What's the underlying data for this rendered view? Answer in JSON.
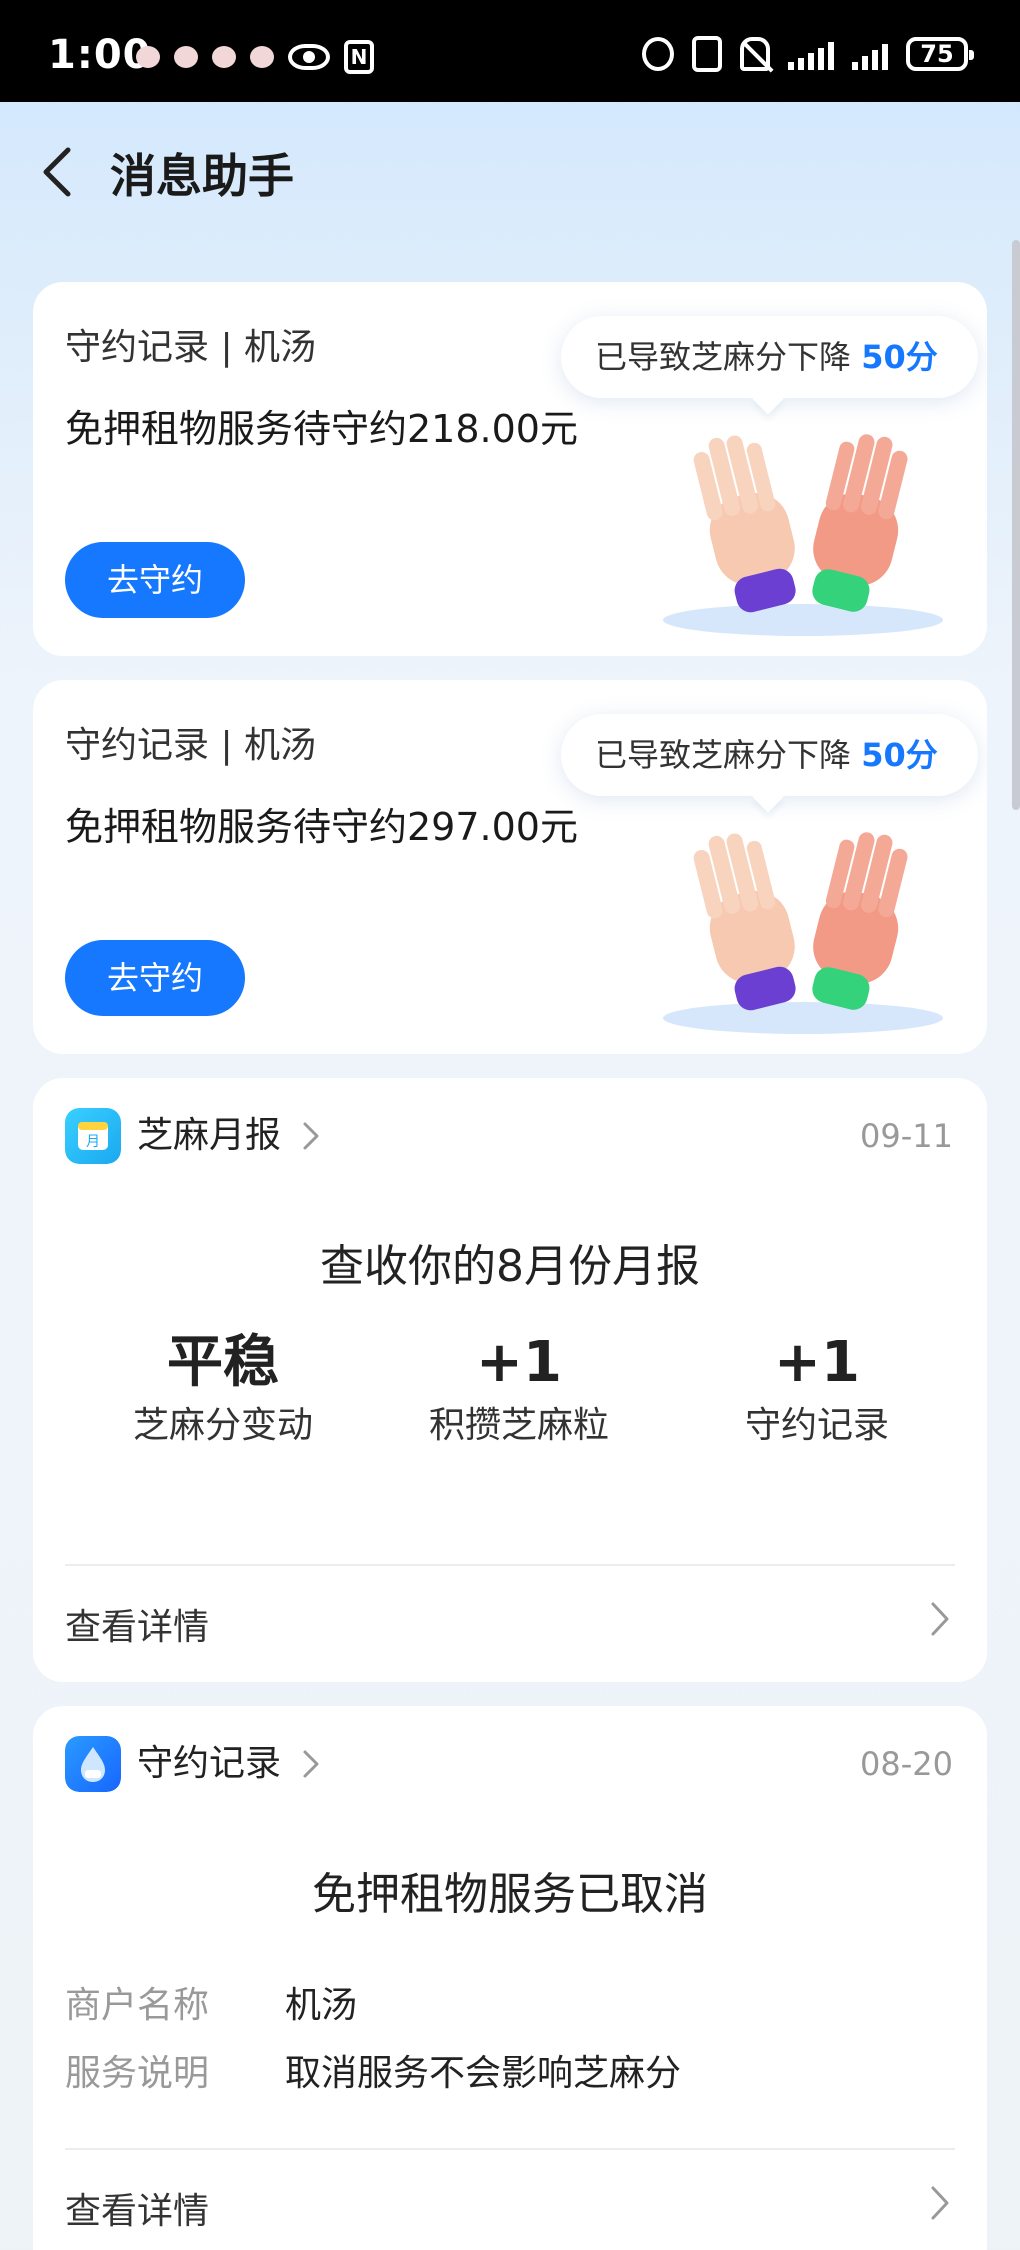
{
  "status_bar": {
    "time": "1:00",
    "battery": "75",
    "icons": [
      "notification-icon",
      "notification-icon",
      "notification-icon",
      "notification-icon",
      "eye-icon",
      "nfc-icon",
      "alarm-icon",
      "bluetooth-icon",
      "vibrate-icon",
      "mute-icon",
      "signal-icon",
      "signal-icon",
      "battery-icon"
    ]
  },
  "header": {
    "title": "消息助手",
    "back_icon": "chevron-left-icon"
  },
  "pending_cards": [
    {
      "tag": "守约记录 | 机汤",
      "title": "免押租物服务待守约218.00元",
      "button": "去守约",
      "bubble_text": "已导致芝麻分下降",
      "bubble_highlight": "50分"
    },
    {
      "tag": "守约记录 | 机汤",
      "title": "免押租物服务待守约297.00元",
      "button": "去守约",
      "bubble_text": "已导致芝麻分下降",
      "bubble_highlight": "50分"
    }
  ],
  "monthly_report": {
    "icon": "calendar-icon",
    "icon_text": "月",
    "name": "芝麻月报",
    "date": "09-11",
    "heading": "查收你的8月份月报",
    "stats": [
      {
        "value": "平稳",
        "label": "芝麻分变动"
      },
      {
        "value": "+1",
        "label": "积攒芝麻粒"
      },
      {
        "value": "+1",
        "label": "守约记录"
      }
    ],
    "detail": "查看详情"
  },
  "contract_record": {
    "icon": "droplet-icon",
    "name": "守约记录",
    "date": "08-20",
    "heading": "免押租物服务已取消",
    "rows": [
      {
        "key": "商户名称",
        "value": "机汤"
      },
      {
        "key": "服务说明",
        "value": "取消服务不会影响芝麻分"
      }
    ],
    "detail": "查看详情"
  },
  "colors": {
    "accent": "#1677ff",
    "page_bg": "#e4eef9"
  }
}
